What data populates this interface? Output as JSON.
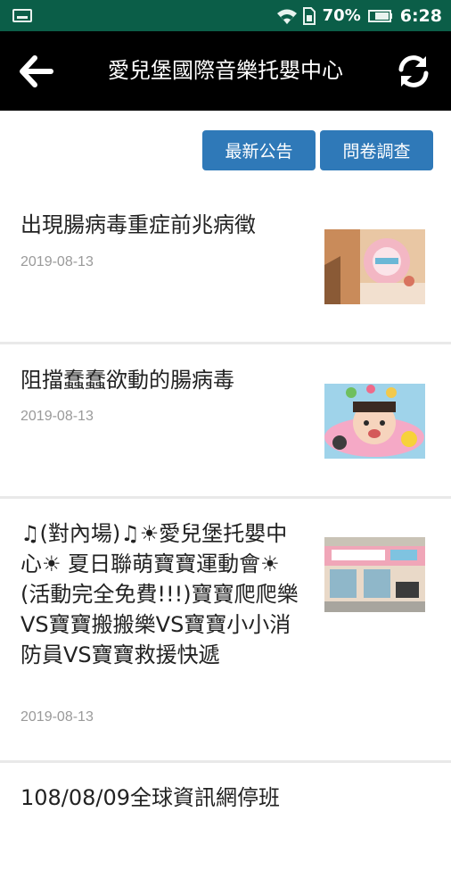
{
  "status_bar": {
    "battery_percent": "70%",
    "time": "6:28"
  },
  "toolbar": {
    "title": "愛兒堡國際音樂托嬰中心",
    "back_icon": "arrow-left-icon",
    "refresh_icon": "refresh-icon"
  },
  "actions": {
    "news_label": "最新公告",
    "survey_label": "問卷調查",
    "accent_color": "#2f79b8"
  },
  "items": [
    {
      "title": "出現腸病毒重症前兆病徵",
      "date": "2019-08-13"
    },
    {
      "title": "阻擋蠢蠢欲動的腸病毒",
      "date": "2019-08-13"
    },
    {
      "title": "♫(對內場)♫☀愛兒堡托嬰中心☀ 夏日聯萌寶寶運動會☀(活動完全免費!!!)寶寶爬爬樂VS寶寶搬搬樂VS寶寶小小消防員VS寶寶救援快遞",
      "date": "2019-08-13"
    },
    {
      "title": "108/08/09全球資訊網停班",
      "date": ""
    }
  ]
}
